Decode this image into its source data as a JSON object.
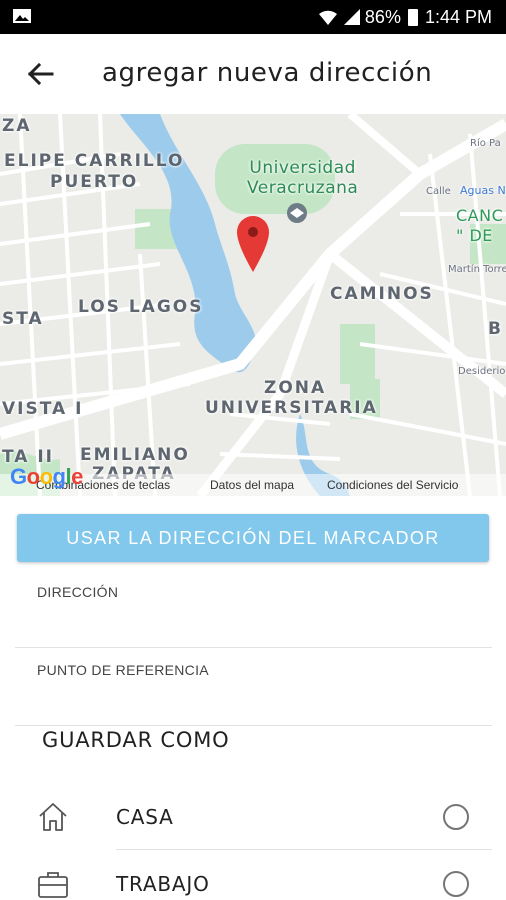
{
  "status_bar": {
    "battery": "86%",
    "time": "1:44 PM",
    "icons": [
      "image-icon",
      "wifi-icon",
      "signal-icon",
      "battery-icon"
    ]
  },
  "header": {
    "title": "agregar nueva dirección",
    "back_icon": "arrow-back-icon"
  },
  "map": {
    "labels": {
      "za": "ZA",
      "felipe_line1": "ELIPE CARRILLO",
      "felipe_line2": "PUERTO",
      "univ_line1": "Universidad",
      "univ_line2": "Veracruzana",
      "los_lagos": "LOS LAGOS",
      "sta": "STA",
      "caminos": "CAMINOS",
      "b": "B",
      "zona_line1": "ZONA",
      "zona_line2": "UNIVERSITARIA",
      "vista": "VISTA I",
      "ta_ii": "TA II",
      "emiliano": "EMILIANO",
      "zapata": "ZAPATA",
      "rio_pa": "Río Pa",
      "aguas_n": "Aguas N",
      "calle": "Calle",
      "canc_line1": "CANC",
      "canc_line2": "\" DE",
      "martin_torres": "Martín Torres",
      "desiderio": "Desiderio"
    },
    "footer": {
      "keyboard": "Combinaciones de teclas",
      "data": "Datos del mapa",
      "terms": "Condiciones del Servicio"
    },
    "google_logo": "Google",
    "pin_color": "#e53935"
  },
  "actions": {
    "use_marker_label": "USAR LA DIRECCIÓN DEL MARCADOR"
  },
  "form": {
    "direccion_label": "DIRECCIÓN",
    "direccion_value": "",
    "referencia_label": "PUNTO DE REFERENCIA",
    "referencia_value": ""
  },
  "save_as": {
    "title": "GUARDAR COMO",
    "options": [
      {
        "label": "CASA",
        "icon": "home-icon",
        "selected": false
      },
      {
        "label": "TRABAJO",
        "icon": "briefcase-icon",
        "selected": false
      }
    ]
  },
  "colors": {
    "button": "#82c8ec",
    "water": "#9ccbec",
    "park": "#c4e6c6",
    "map_bg": "#ebebe7"
  }
}
